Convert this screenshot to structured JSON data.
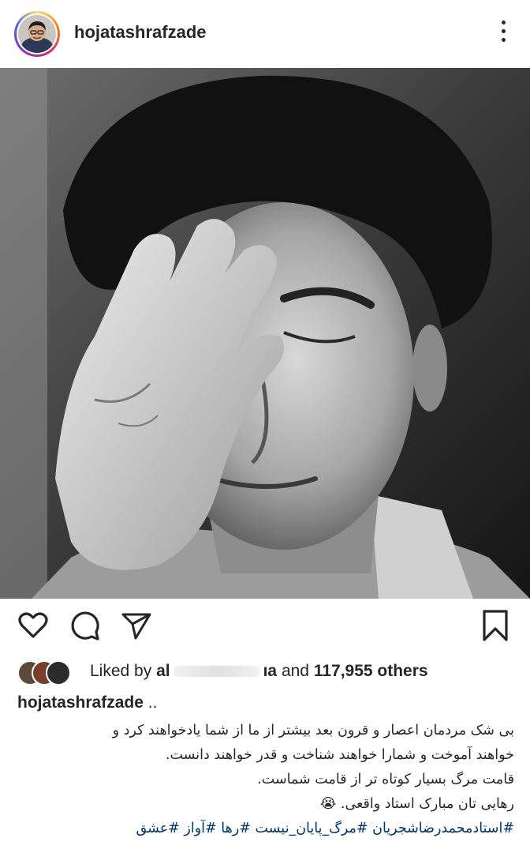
{
  "post": {
    "username": "hojatashrafzade",
    "likes": {
      "prefix": "Liked by",
      "user_visible": "al",
      "user_tail": "ıa",
      "and_label": "and",
      "count_text": "117,955 others"
    },
    "caption": {
      "username": "hojatashrafzade",
      "ellipsis": " ..",
      "lines": [
        "بی شک مردمان اعصار و قرون بعد بیشتر از ما از شما یادخواهند کرد و",
        "خواهند آموخت و شمارا خواهند شناخت و قدر خواهند دانست.",
        "قامت مرگ بسیار کوتاه تر از قامت شماست.",
        "رهایی تان مبارک استاد واقعی. 😭"
      ],
      "hashtags": "#استادمحمدرضاشجریان #مرگ_پایان_نیست #رها #آواز #عشق"
    }
  },
  "icons": {
    "more": "more-vertical-icon",
    "like": "heart-icon",
    "comment": "comment-icon",
    "share": "send-icon",
    "save": "bookmark-icon"
  },
  "colors": {
    "text": "#262626",
    "hashtag": "#003569",
    "story_ring": "#d62976"
  }
}
